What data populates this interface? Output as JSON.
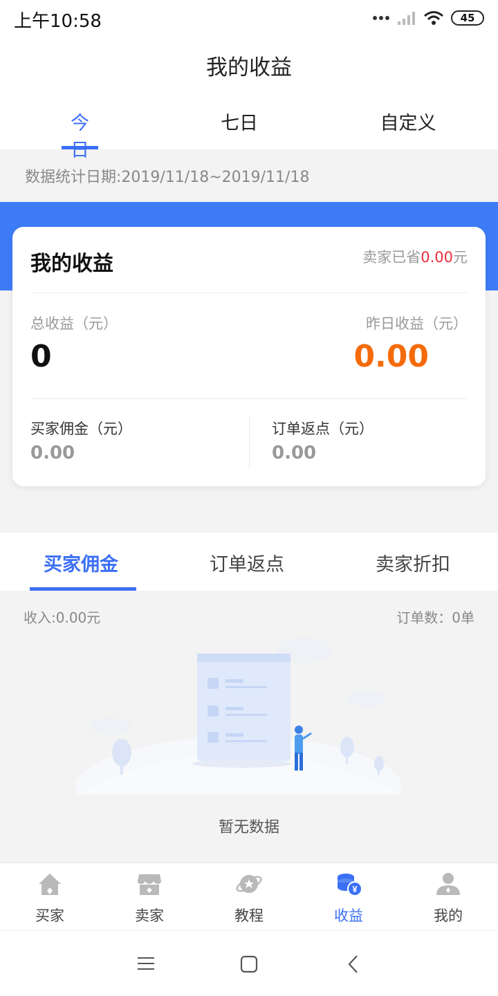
{
  "status_bar": {
    "time": "上午10:58",
    "battery": "45"
  },
  "header": {
    "title": "我的收益"
  },
  "period_tabs": [
    {
      "label": "今日",
      "active": true
    },
    {
      "label": "七日",
      "active": false
    },
    {
      "label": "自定义",
      "active": false
    }
  ],
  "date_range": "数据统计日期:2019/11/18~2019/11/18",
  "earnings_card": {
    "title": "我的收益",
    "seller_saved_prefix": "卖家已省",
    "seller_saved_value": "0.00",
    "seller_saved_suffix": "元",
    "total_label": "总收益（元）",
    "total_value": "0",
    "yesterday_label": "昨日收益（元）",
    "yesterday_value": "0.00",
    "buyer_commission_label": "买家佣金（元）",
    "buyer_commission_value": "0.00",
    "order_rebate_label": "订单返点（元）",
    "order_rebate_value": "0.00"
  },
  "category_tabs": [
    {
      "label": "买家佣金",
      "active": true
    },
    {
      "label": "订单返点",
      "active": false
    },
    {
      "label": "卖家折扣",
      "active": false
    }
  ],
  "summary": {
    "income": "收入:0.00元",
    "orders": "订单数：0单"
  },
  "empty_state": {
    "text": "暂无数据"
  },
  "bottom_nav": [
    {
      "label": "买家",
      "icon": "house-icon",
      "active": false
    },
    {
      "label": "卖家",
      "icon": "store-icon",
      "active": false
    },
    {
      "label": "教程",
      "icon": "planet-icon",
      "active": false
    },
    {
      "label": "收益",
      "icon": "coins-icon",
      "active": true
    },
    {
      "label": "我的",
      "icon": "person-icon",
      "active": false
    }
  ],
  "colors": {
    "accent": "#3b6ff5",
    "banner": "#3e7cf7",
    "earnings_orange": "#f56b0a",
    "saved_red": "#f02d3a"
  }
}
